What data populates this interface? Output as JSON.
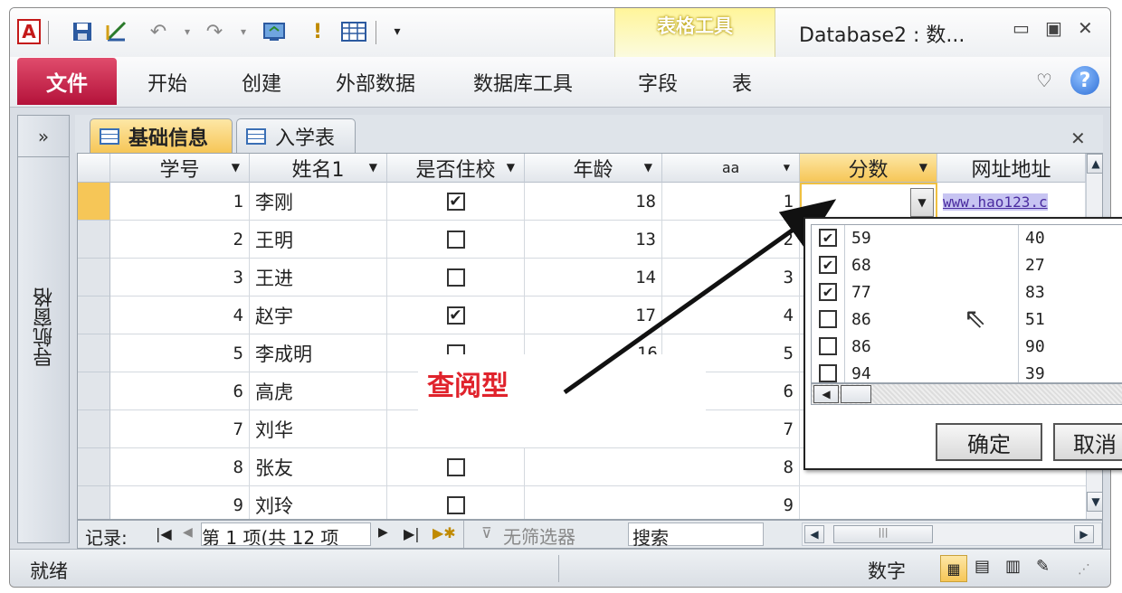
{
  "titlebar": {
    "app_icon": "A",
    "window_title": "Database2 : 数...",
    "context_label": "表格工具",
    "icons": [
      "access-logo-icon",
      "save-icon",
      "design-view-icon",
      "undo-icon",
      "redo-icon",
      "refresh-icon",
      "run-icon",
      "datasheet-icon",
      "customize-qat-icon"
    ]
  },
  "ribbon": {
    "file_tab": "文件",
    "tabs": [
      "开始",
      "创建",
      "外部数据",
      "数据库工具"
    ],
    "context_tabs": [
      "字段",
      "表"
    ],
    "help_glyph": "?"
  },
  "nav_pane": {
    "toggle_glyph": "»",
    "label": "导航窗格"
  },
  "doc_tabs": [
    {
      "label": "基础信息",
      "active": true
    },
    {
      "label": "入学表",
      "active": false
    }
  ],
  "grid": {
    "columns": [
      "学号",
      "姓名1",
      "是否住校",
      "年龄",
      "aa",
      "分数",
      "网址地址"
    ],
    "rows": [
      {
        "id": "1",
        "name": "李刚",
        "resident": true,
        "age": "18",
        "aa": "1",
        "score": "",
        "url": "www.hao123.c"
      },
      {
        "id": "2",
        "name": "王明",
        "resident": false,
        "age": "13",
        "aa": "2"
      },
      {
        "id": "3",
        "name": "王进",
        "resident": false,
        "age": "14",
        "aa": "3"
      },
      {
        "id": "4",
        "name": "赵宇",
        "resident": true,
        "age": "17",
        "aa": "4"
      },
      {
        "id": "5",
        "name": "李成明",
        "resident": false,
        "age": "16",
        "aa": "5"
      },
      {
        "id": "6",
        "name": "高虎",
        "resident": null,
        "age": "",
        "aa": "6"
      },
      {
        "id": "7",
        "name": "刘华",
        "resident": null,
        "age": "",
        "aa": "7"
      },
      {
        "id": "8",
        "name": "张友",
        "resident": false,
        "age": "",
        "aa": "8"
      },
      {
        "id": "9",
        "name": "刘玲",
        "resident": false,
        "age": "",
        "aa": "9"
      }
    ]
  },
  "lookup_popup": {
    "items": [
      {
        "checked": true,
        "a": "59",
        "b": "40"
      },
      {
        "checked": true,
        "a": "68",
        "b": "27"
      },
      {
        "checked": true,
        "a": "77",
        "b": "83"
      },
      {
        "checked": false,
        "a": "86",
        "b": "51"
      },
      {
        "checked": false,
        "a": "86",
        "b": "90"
      },
      {
        "checked": false,
        "a": "94",
        "b": "39"
      }
    ],
    "ok_label": "确定",
    "cancel_label": "取消"
  },
  "annotation": {
    "text": "查阅型",
    "color": "#e0232c"
  },
  "record_nav": {
    "label": "记录:",
    "position": "第 1 项(共 12 项",
    "filter_label": "无筛选器",
    "search_label": "搜索"
  },
  "statusbar": {
    "left": "就绪",
    "mode": "数字"
  },
  "colors": {
    "file_tab": "#c41a45",
    "active_doc_tab": "#f6c657",
    "context_tools": "#fff59a"
  }
}
